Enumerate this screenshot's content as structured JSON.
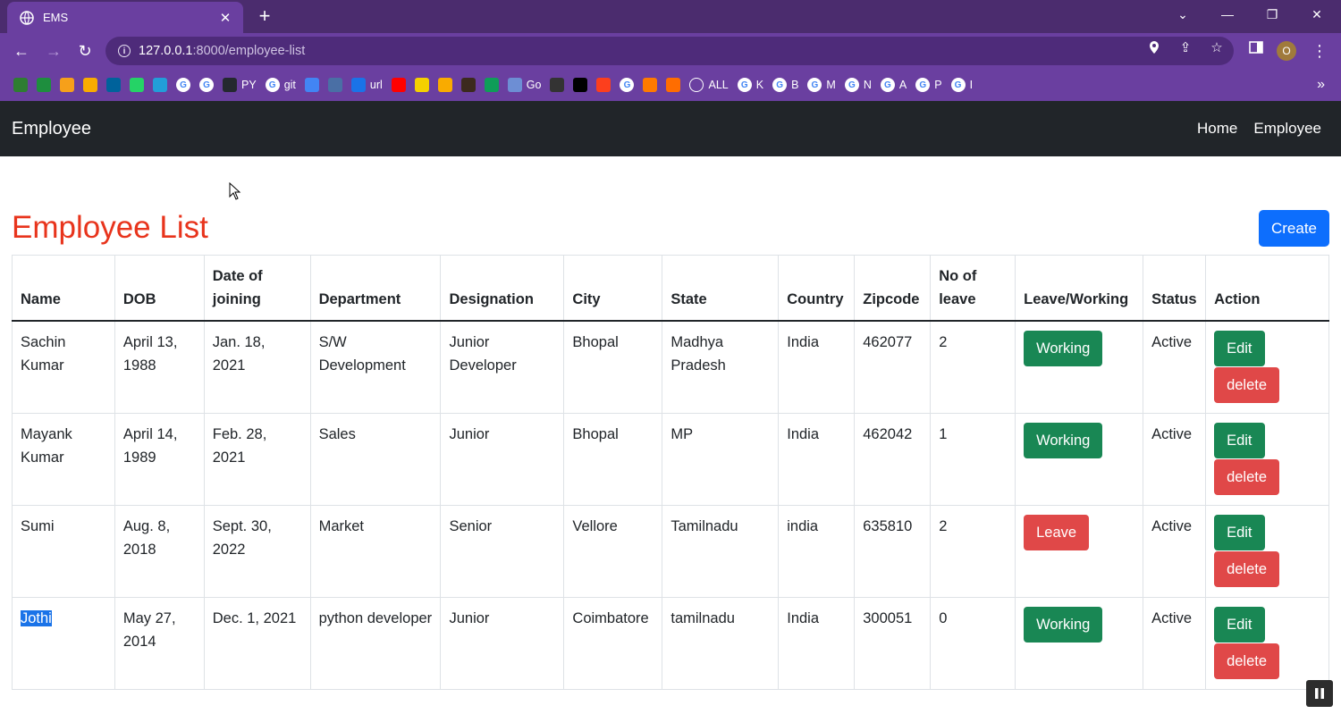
{
  "browser": {
    "tab_title": "EMS",
    "tab_close": "✕",
    "new_tab": "+",
    "url_host": "127.0.0.1",
    "url_rest": ":8000/employee-list",
    "profile_initial": "O",
    "bookmarks": [
      {
        "icon": "bookmark-icon-1",
        "label": "",
        "color": "#2e7d32"
      },
      {
        "icon": "bookmark-icon-2",
        "label": "",
        "color": "#1e8e3e"
      },
      {
        "icon": "bookmark-icon-3",
        "label": "",
        "color": "#f6a01a"
      },
      {
        "icon": "analytics-icon",
        "label": "",
        "color": "#f9ab00"
      },
      {
        "icon": "ieee-icon",
        "label": "",
        "color": "#00629b"
      },
      {
        "icon": "whatsapp-icon",
        "label": "",
        "color": "#25d366"
      },
      {
        "icon": "telegram-icon",
        "label": "",
        "color": "#229ed9"
      },
      {
        "icon": "google-icon",
        "label": "",
        "color": "#ffffff"
      },
      {
        "icon": "google-icon",
        "label": "",
        "color": "#ffffff"
      },
      {
        "icon": "github-icon",
        "label": "PY",
        "color": "#24292f"
      },
      {
        "icon": "google-icon",
        "label": "git",
        "color": "#ffffff"
      },
      {
        "icon": "bookmark-icon-4",
        "label": "",
        "color": "#4285f4"
      },
      {
        "icon": "bookmark-icon-5",
        "label": "",
        "color": "#4a6fa5"
      },
      {
        "icon": "bookmark-icon-6",
        "label": "url",
        "color": "#1a73e8"
      },
      {
        "icon": "youtube-icon",
        "label": "",
        "color": "#ff0000"
      },
      {
        "icon": "bookmark-icon-7",
        "label": "",
        "color": "#f5d000"
      },
      {
        "icon": "bookmark-icon-8",
        "label": "",
        "color": "#f9ab00"
      },
      {
        "icon": "bookmark-icon-9",
        "label": "",
        "color": "#3c2a1e"
      },
      {
        "icon": "bookmark-icon-10",
        "label": "",
        "color": "#0f9d58"
      },
      {
        "icon": "bookmark-icon-11",
        "label": "Go",
        "color": "#6d8ed4"
      },
      {
        "icon": "bookmark-icon-12",
        "label": "",
        "color": "#333333"
      },
      {
        "icon": "bookmark-icon-13",
        "label": "",
        "color": "#000000"
      },
      {
        "icon": "yandex-icon",
        "label": "",
        "color": "#fc3f1d"
      },
      {
        "icon": "google-icon",
        "label": "",
        "color": "#ffffff"
      },
      {
        "icon": "bookmark-icon-14",
        "label": "",
        "color": "#ff7a00"
      },
      {
        "icon": "bookmark-icon-15",
        "label": "",
        "color": "#ff6d00"
      },
      {
        "icon": "globe-icon",
        "label": "ALL",
        "color": "#ffffff"
      },
      {
        "icon": "google-icon",
        "label": "K",
        "color": "#ffffff"
      },
      {
        "icon": "google-icon",
        "label": "B",
        "color": "#ffffff"
      },
      {
        "icon": "google-icon",
        "label": "M",
        "color": "#ffffff"
      },
      {
        "icon": "google-icon",
        "label": "N",
        "color": "#ffffff"
      },
      {
        "icon": "google-icon",
        "label": "A",
        "color": "#ffffff"
      },
      {
        "icon": "google-icon",
        "label": "P",
        "color": "#ffffff"
      },
      {
        "icon": "google-icon",
        "label": "I",
        "color": "#ffffff"
      }
    ]
  },
  "navbar": {
    "brand": "Employee",
    "links": [
      "Home",
      "Employee"
    ]
  },
  "page": {
    "title": "Employee List",
    "create_label": "Create"
  },
  "table": {
    "headers": [
      "Name",
      "DOB",
      "Date of joining",
      "Department",
      "Designation",
      "City",
      "State",
      "Country",
      "Zipcode",
      "No of leave",
      "Leave/Working",
      "Status",
      "Action"
    ],
    "edit_label": "Edit",
    "delete_label": "delete",
    "rows": [
      {
        "name": "Sachin Kumar",
        "dob": "April 13, 1988",
        "doj": "Jan. 18, 2021",
        "department": "S/W Development",
        "designation": "Junior Developer",
        "city": "Bhopal",
        "state": "Madhya Pradesh",
        "country": "India",
        "zipcode": "462077",
        "leaves": "2",
        "work_status": "Working",
        "status": "Active"
      },
      {
        "name": "Mayank Kumar",
        "dob": "April 14, 1989",
        "doj": "Feb. 28, 2021",
        "department": "Sales",
        "designation": "Junior",
        "city": "Bhopal",
        "state": "MP",
        "country": "India",
        "zipcode": "462042",
        "leaves": "1",
        "work_status": "Working",
        "status": "Active"
      },
      {
        "name": "Sumi",
        "dob": "Aug. 8, 2018",
        "doj": "Sept. 30, 2022",
        "department": "Market",
        "designation": "Senior",
        "city": "Vellore",
        "state": "Tamilnadu",
        "country": "india",
        "zipcode": "635810",
        "leaves": "2",
        "work_status": "Leave",
        "status": "Active"
      },
      {
        "name": "Jothi",
        "dob": "May 27, 2014",
        "doj": "Dec. 1, 2021",
        "department": "python developer",
        "designation": "Junior",
        "city": "Coimbatore",
        "state": "tamilnadu",
        "country": "India",
        "zipcode": "300051",
        "leaves": "0",
        "work_status": "Working",
        "status": "Active"
      }
    ]
  },
  "colors": {
    "title": "#e8341c",
    "navbar_bg": "#212529",
    "working": "#198754",
    "leave": "#e04848",
    "create": "#0d6efd"
  }
}
